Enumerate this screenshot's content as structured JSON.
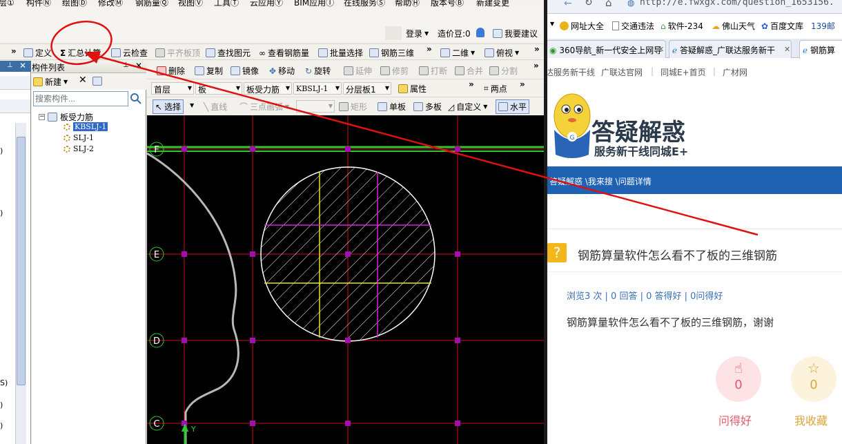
{
  "app": {
    "menu": [
      "层①",
      "构件Ⓝ",
      "绘图Ⓓ",
      "修改Ⓜ",
      "钢筋量Ⓠ",
      "视图Ⓥ",
      "工具Ⓣ",
      "云应用Ⓨ",
      "BIM应用Ⓘ",
      "在线服务Ⓢ",
      "帮助Ⓗ",
      "版本号Ⓑ",
      "新建变更"
    ],
    "topbar": {
      "login": "登录",
      "price_bean": "造价豆:0",
      "suggest": "我要建议"
    },
    "toolbar1": {
      "define": "定义",
      "sum_calc": "汇总计算",
      "cloud_check": "云检查",
      "flush_slab": "平齐板顶",
      "find_element": "查找图元",
      "view_rebar": "查看钢筋量",
      "batch_select": "批量选择",
      "rebar_3d": "钢筋三维",
      "view_2d": "二维",
      "view_top": "俯视"
    },
    "panel": {
      "title": "构件列表",
      "new": "新建",
      "search_placeholder": "搜索构件...",
      "tree_root": "板受力筋",
      "items": [
        "KBSLJ-1",
        "SLJ-1",
        "SLJ-2"
      ]
    },
    "toolbar2": {
      "delete": "删除",
      "copy": "复制",
      "mirror": "镜像",
      "move": "移动",
      "rotate": "旋转",
      "extend": "延伸",
      "trim": "修剪",
      "break": "打断",
      "merge": "合并",
      "split": "分割"
    },
    "toolbar3": {
      "floor": "首层",
      "category": "板",
      "type": "板受力筋",
      "element": "KBSLJ-1",
      "layer": "分层板1",
      "property": "属性",
      "two_point": "两点"
    },
    "toolbar4": {
      "select": "选择",
      "line": "直线",
      "arc": "三点画弧",
      "rect": "矩形",
      "single_slab": "单板",
      "multi_slab": "多板",
      "custom": "自定义",
      "horizontal": "水平"
    },
    "left_strip_fragments": [
      ")",
      ")",
      "S)",
      ")",
      ")"
    ],
    "axis_labels": [
      "F",
      "E",
      "D",
      "C"
    ],
    "axis_y": "Y",
    "colors": {
      "grid": "#d0101c",
      "beam": "#2fc92f",
      "node": "#a010b0",
      "hatch": "#ffffff",
      "magenta": "#e020e0",
      "yellow": "#e8e820"
    }
  },
  "browser": {
    "url": "http://e.fwxgx.com/question_1653156.",
    "bookmarks": [
      "网址大全",
      "交通违法",
      "软件-234",
      "佛山天气",
      "百度文库",
      "139邮"
    ],
    "tabs": [
      "360导航_新一代安全上网导",
      "答疑解惑_广联达服务新干",
      "钢筋算"
    ],
    "site_nav": [
      "达服务新干线",
      "广联达官网",
      "同城E+首页",
      "广材网"
    ],
    "logo_title": "答疑解惑",
    "logo_subtitle": "服务新干线同城E+",
    "breadcrumb": "答疑解惑 \\我来搜 \\问题详情",
    "question_title": "钢筋算量软件怎么看不了板的三维钢筋",
    "stats": "浏览3 次 | 0 回答 | 0 答得好 | 0问得好",
    "question_body": "钢筋算量软件怎么看不了板的三维钢筋，谢谢",
    "actions": [
      {
        "count": "0",
        "label": "问得好",
        "color": "#e05a6a",
        "bg": "#fde3e6"
      },
      {
        "count": "0",
        "label": "我收藏",
        "color": "#d9a53a",
        "bg": "#fdf2dc"
      }
    ]
  },
  "annotation": {
    "color": "#e01010"
  }
}
